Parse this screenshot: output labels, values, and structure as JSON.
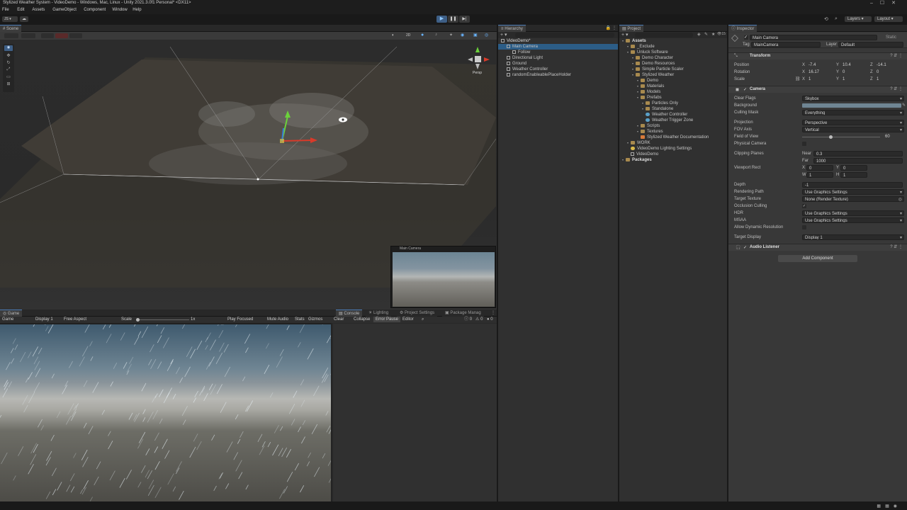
{
  "window": {
    "title": "Stylized Weather System - VideoDemo - Windows, Mac, Linux - Unity 2021.3.0f1 Personal* <DX11>"
  },
  "menu": [
    "File",
    "Edit",
    "Assets",
    "GameObject",
    "Component",
    "Window",
    "Help"
  ],
  "toolbar": {
    "layers": "Layers",
    "layout": "Layout",
    "account": "JS"
  },
  "scene": {
    "tab": "Scene",
    "persp": "Persp",
    "mode_2d": "2D"
  },
  "camera_preview": {
    "title": "Main Camera"
  },
  "game": {
    "tab": "Game",
    "mode": "Game",
    "display": "Display 1",
    "aspect": "Free Aspect",
    "scale_label": "Scale",
    "scale_value": "1x",
    "play_focused": "Play Focused",
    "mute": "Mute Audio",
    "stats": "Stats",
    "gizmos": "Gizmos"
  },
  "console": {
    "tabs": [
      "Console",
      "Lighting",
      "Project Settings",
      "Package Manag"
    ],
    "clear": "Clear",
    "collapse": "Collapse",
    "error_pause": "Error Pause",
    "editor": "Editor",
    "count_warn": "0",
    "count_err": "0",
    "count_info": "0"
  },
  "hierarchy": {
    "tab": "Hierarchy",
    "items": [
      {
        "label": "VideoDemo*",
        "depth": 0,
        "kind": "scene"
      },
      {
        "label": "Main Camera",
        "depth": 1,
        "kind": "obj",
        "selected": true
      },
      {
        "label": "Follow",
        "depth": 2,
        "kind": "obj"
      },
      {
        "label": "Directional Light",
        "depth": 1,
        "kind": "obj"
      },
      {
        "label": "Ground",
        "depth": 1,
        "kind": "obj"
      },
      {
        "label": "Weather Controller",
        "depth": 1,
        "kind": "obj"
      },
      {
        "label": "randomEnableablePlaceHolder",
        "depth": 1,
        "kind": "obj"
      }
    ]
  },
  "project": {
    "tab": "Project",
    "count": "15",
    "items": [
      {
        "label": "Assets",
        "depth": 0,
        "kind": "folder",
        "bold": true
      },
      {
        "label": "_Exclude",
        "depth": 1,
        "kind": "folder"
      },
      {
        "label": "Unluck Software",
        "depth": 1,
        "kind": "folder"
      },
      {
        "label": "Demo Character",
        "depth": 2,
        "kind": "folder"
      },
      {
        "label": "Demo Resources",
        "depth": 2,
        "kind": "folder"
      },
      {
        "label": "Simple Particle Scaler",
        "depth": 2,
        "kind": "folder"
      },
      {
        "label": "Stylized Weather",
        "depth": 2,
        "kind": "folder"
      },
      {
        "label": "Demo",
        "depth": 3,
        "kind": "folder"
      },
      {
        "label": "Materials",
        "depth": 3,
        "kind": "folder"
      },
      {
        "label": "Models",
        "depth": 3,
        "kind": "folder"
      },
      {
        "label": "Prefabs",
        "depth": 3,
        "kind": "folder"
      },
      {
        "label": "Particles Only",
        "depth": 4,
        "kind": "folder"
      },
      {
        "label": "Standalone",
        "depth": 4,
        "kind": "folder"
      },
      {
        "label": "Weather Controller",
        "depth": 4,
        "kind": "prefab"
      },
      {
        "label": "Weather Trigger Zone",
        "depth": 4,
        "kind": "prefab"
      },
      {
        "label": "Scripts",
        "depth": 3,
        "kind": "folder"
      },
      {
        "label": "Textures",
        "depth": 3,
        "kind": "folder"
      },
      {
        "label": "Stylized Weather Documentation",
        "depth": 3,
        "kind": "doc"
      },
      {
        "label": "WORK",
        "depth": 1,
        "kind": "folder"
      },
      {
        "label": "VideoDemo Lighting Settings",
        "depth": 1,
        "kind": "settings"
      },
      {
        "label": "VideoDemo",
        "depth": 1,
        "kind": "scenefile"
      },
      {
        "label": "Packages",
        "depth": 0,
        "kind": "folder",
        "bold": true
      }
    ]
  },
  "inspector": {
    "tab": "Inspector",
    "object_name": "Main Camera",
    "static": "Static",
    "tag_label": "Tag",
    "tag": "MainCamera",
    "layer_label": "Layer",
    "layer": "Default",
    "transform": {
      "title": "Transform",
      "rows": [
        {
          "label": "Position",
          "x": "-7.4",
          "y": "10.4",
          "z": "-14.1"
        },
        {
          "label": "Rotation",
          "x": "16.17",
          "y": "0",
          "z": "0"
        },
        {
          "label": "Scale",
          "x": "1",
          "y": "1",
          "z": "1"
        }
      ]
    },
    "camera": {
      "title": "Camera",
      "clear_flags_label": "Clear Flags",
      "clear_flags": "Skybox",
      "background_label": "Background",
      "culling_mask_label": "Culling Mask",
      "culling_mask": "Everything",
      "projection_label": "Projection",
      "projection": "Perspective",
      "fov_axis_label": "FOV Axis",
      "fov_axis": "Vertical",
      "fov_label": "Field of View",
      "fov": "60",
      "physical_label": "Physical Camera",
      "clipping_label": "Clipping Planes",
      "near_label": "Near",
      "near": "0.3",
      "far_label": "Far",
      "far": "1000",
      "viewport_label": "Viewport Rect",
      "vx": "0",
      "vy": "0",
      "vw": "1",
      "vh": "1",
      "depth_label": "Depth",
      "depth": "-1",
      "rendering_path_label": "Rendering Path",
      "rendering_path": "Use Graphics Settings",
      "target_texture_label": "Target Texture",
      "target_texture": "None (Render Texture)",
      "occlusion_label": "Occlusion Culling",
      "hdr_label": "HDR",
      "hdr": "Use Graphics Settings",
      "msaa_label": "MSAA",
      "msaa": "Use Graphics Settings",
      "dynres_label": "Allow Dynamic Resolution",
      "target_display_label": "Target Display",
      "target_display": "Display 1"
    },
    "audio_listener": "Audio Listener",
    "add_component": "Add Component"
  },
  "colors": {
    "accent": "#4b7bb5",
    "selection": "#2c5d87",
    "panel": "#383838",
    "background_swatch": "#6f8593"
  }
}
